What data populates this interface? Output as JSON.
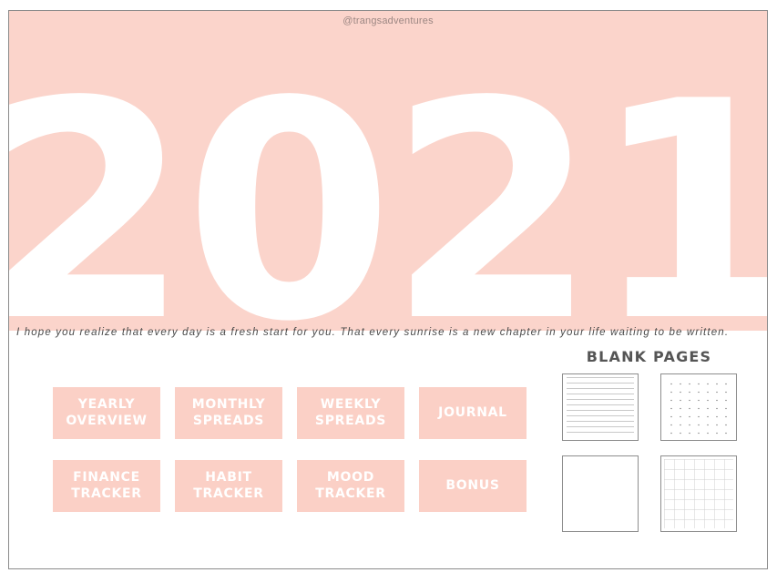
{
  "header": {
    "handle": "@trangsadventures"
  },
  "hero": {
    "year": "2021",
    "background_color": "#fbd4cb",
    "year_color": "#ffffff"
  },
  "quote": {
    "text": "I hope you realize that every day is a fresh start for you. That every sunrise is a new chapter in your life waiting to be written."
  },
  "nav": {
    "buttons": [
      {
        "label": "YEARLY\nOVERVIEW",
        "name": "yearly-overview"
      },
      {
        "label": "MONTHLY\nSPREADS",
        "name": "monthly-spreads"
      },
      {
        "label": "WEEKLY\nSPREADS",
        "name": "weekly-spreads"
      },
      {
        "label": "JOURNAL",
        "name": "journal"
      },
      {
        "label": "FINANCE\nTRACKER",
        "name": "finance-tracker"
      },
      {
        "label": "HABIT\nTRACKER",
        "name": "habit-tracker"
      },
      {
        "label": "MOOD\nTRACKER",
        "name": "mood-tracker"
      },
      {
        "label": "BONUS",
        "name": "bonus"
      }
    ],
    "button_color": "#fbd0c6",
    "button_text_color": "#ffffff"
  },
  "blank_pages": {
    "title": "BLANK PAGES",
    "title_color": "#555555",
    "thumbnails": [
      {
        "style": "lined",
        "name": "lined-page"
      },
      {
        "style": "dotted",
        "name": "dotted-page"
      },
      {
        "style": "plain",
        "name": "plain-page"
      },
      {
        "style": "grid",
        "name": "grid-page"
      }
    ]
  },
  "frame": {
    "border_color": "#8a8a8a"
  }
}
